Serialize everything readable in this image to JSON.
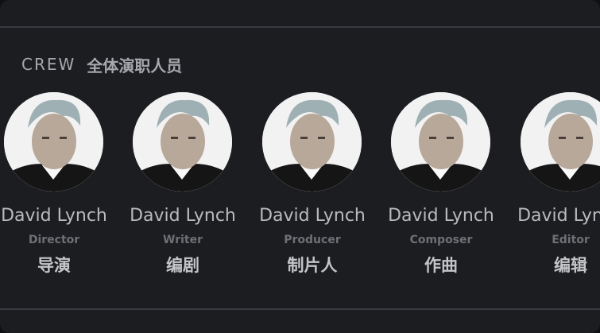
{
  "section": {
    "title_en": "CREW",
    "title_zh": "全体演职人员"
  },
  "crew": [
    {
      "name": "David Lynch",
      "role_en": "Director",
      "role_zh": "导演",
      "avatar_icon": "person-portrait-icon"
    },
    {
      "name": "David Lynch",
      "role_en": "Writer",
      "role_zh": "编剧",
      "avatar_icon": "person-portrait-icon"
    },
    {
      "name": "David Lynch",
      "role_en": "Producer",
      "role_zh": "制片人",
      "avatar_icon": "person-portrait-icon"
    },
    {
      "name": "David Lynch",
      "role_en": "Composer",
      "role_zh": "作曲",
      "avatar_icon": "person-portrait-icon"
    },
    {
      "name": "David Lynch",
      "role_en": "Editor",
      "role_zh": "编辑",
      "avatar_icon": "person-portrait-icon"
    }
  ],
  "colors": {
    "background": "#1c1d21",
    "text_primary": "#b9babe",
    "text_secondary": "#6f7075"
  }
}
